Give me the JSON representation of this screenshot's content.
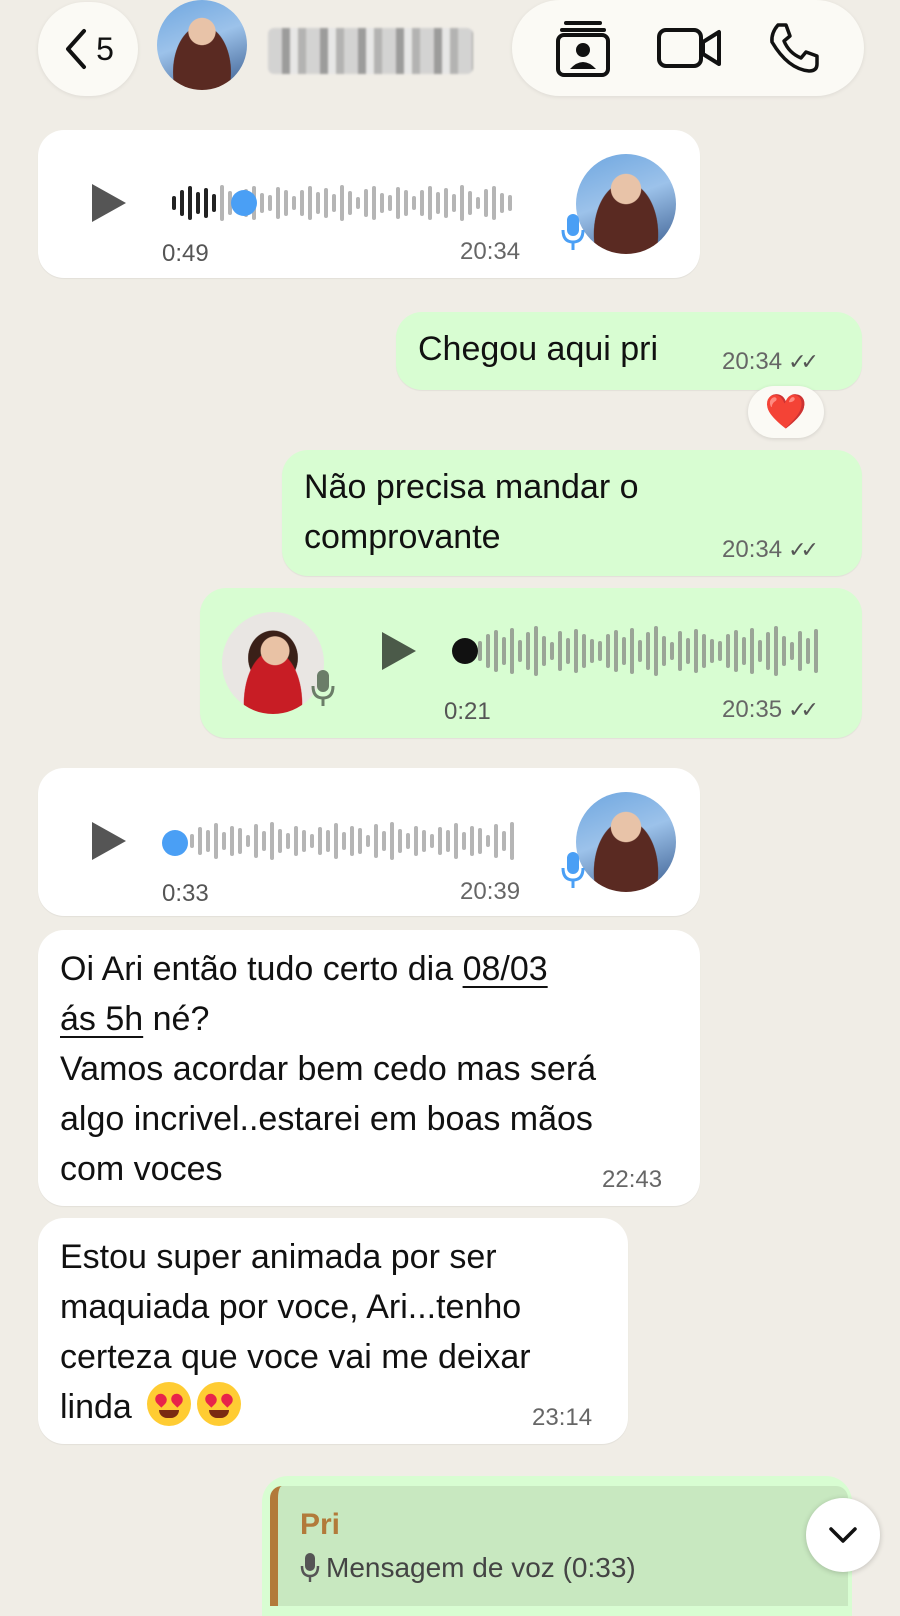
{
  "header": {
    "back_count": "5",
    "contact_name": "",
    "actions": [
      "contact-card-icon",
      "video-call-icon",
      "voice-call-icon"
    ]
  },
  "messages": [
    {
      "type": "voice",
      "direction": "in",
      "duration": "0:49",
      "time": "20:34",
      "progress": 0.13
    },
    {
      "type": "text",
      "direction": "out",
      "text": "Chegou aqui pri",
      "time": "20:34",
      "reaction": "❤️"
    },
    {
      "type": "text",
      "direction": "out",
      "line1": "Não precisa mandar o",
      "line2": "comprovante",
      "time": "20:34"
    },
    {
      "type": "voice",
      "direction": "out",
      "duration": "0:21",
      "time": "20:35",
      "progress": 0
    },
    {
      "type": "voice",
      "direction": "in",
      "duration": "0:33",
      "time": "20:39",
      "progress": 0
    },
    {
      "type": "text",
      "direction": "in",
      "line1a": "Oi Ari então tudo certo dia ",
      "line1b": "08/03",
      "line2a": "ás 5h",
      "line2b": " né?",
      "line3": "Vamos acordar bem cedo mas será",
      "line4": "algo incrivel..estarei em boas mãos",
      "line5": "com voces",
      "time": "22:43"
    },
    {
      "type": "text",
      "direction": "in",
      "line1": "Estou super animada por ser",
      "line2": "maquiada por voce, Ari...tenho",
      "line3": "certeza que voce vai me deixar",
      "line4": "linda",
      "time": "23:14"
    }
  ],
  "reply_preview": {
    "sender": "Pri",
    "label": "Mensagem de voz (0:33)"
  },
  "colors": {
    "chat_bg": "#f0ede6",
    "incoming": "#ffffff",
    "outgoing": "#d8fdd2",
    "play_progress": "#4a9ff5"
  }
}
